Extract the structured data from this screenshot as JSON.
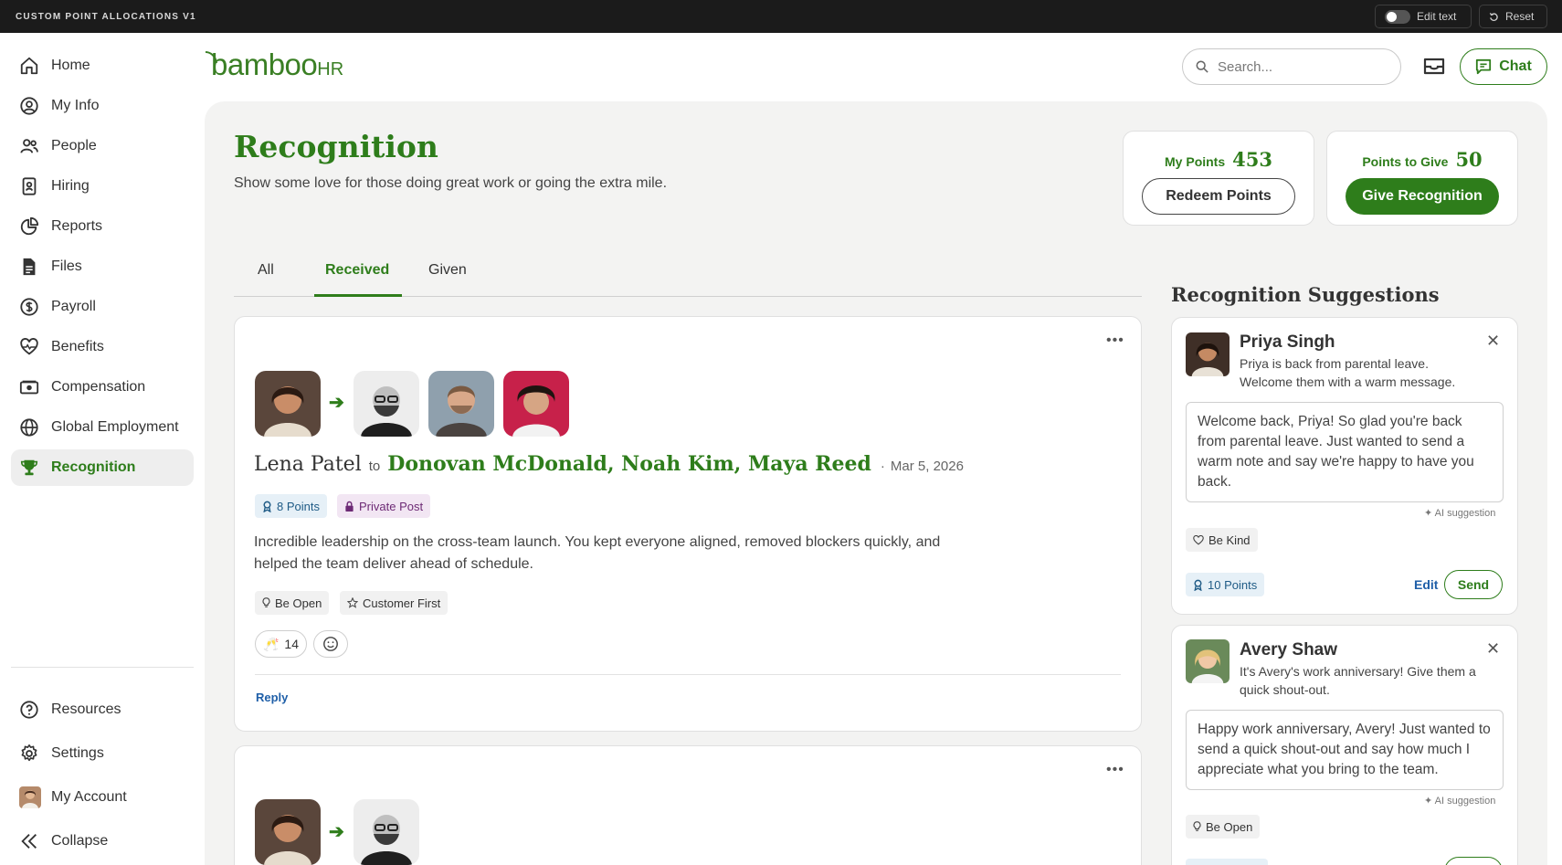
{
  "topbar": {
    "title": "CUSTOM POINT ALLOCATIONS V1",
    "edit_text": "Edit text",
    "reset": "Reset"
  },
  "sidebar": {
    "items": [
      {
        "label": "Home",
        "icon": "home-icon"
      },
      {
        "label": "My Info",
        "icon": "user-circle-icon"
      },
      {
        "label": "People",
        "icon": "people-icon"
      },
      {
        "label": "Hiring",
        "icon": "badge-icon"
      },
      {
        "label": "Reports",
        "icon": "pie-chart-icon"
      },
      {
        "label": "Files",
        "icon": "file-icon"
      },
      {
        "label": "Payroll",
        "icon": "dollar-circle-icon"
      },
      {
        "label": "Benefits",
        "icon": "heart-pulse-icon"
      },
      {
        "label": "Compensation",
        "icon": "cash-icon"
      },
      {
        "label": "Global Employment",
        "icon": "globe-icon"
      },
      {
        "label": "Recognition",
        "icon": "trophy-icon",
        "active": true
      }
    ],
    "bottom": [
      {
        "label": "Resources",
        "icon": "help-circle-icon"
      },
      {
        "label": "Settings",
        "icon": "gear-icon"
      },
      {
        "label": "My Account",
        "icon": "avatar"
      },
      {
        "label": "Collapse",
        "icon": "collapse-icon"
      }
    ]
  },
  "header": {
    "logo_main": "bamboo",
    "logo_hr": "HR",
    "search_placeholder": "Search...",
    "chat": "Chat"
  },
  "page": {
    "title": "Recognition",
    "subtitle": "Show some love for those doing great work or going the extra mile."
  },
  "points": {
    "my_points_label": "My Points",
    "my_points_value": "453",
    "redeem": "Redeem Points",
    "to_give_label": "Points to Give",
    "to_give_value": "50",
    "give": "Give Recognition"
  },
  "tabs": [
    {
      "label": "All"
    },
    {
      "label": "Received",
      "active": true
    },
    {
      "label": "Given"
    }
  ],
  "feed": [
    {
      "from": "Lena Patel",
      "to_word": "to",
      "recipients": "Donovan McDonald, Noah Kim, Maya Reed",
      "date": "Mar 5, 2026",
      "points": "8 Points",
      "privacy": "Private Post",
      "message": "Incredible leadership on the cross-team launch. You kept everyone aligned, removed blockers quickly, and helped the team deliver ahead of schedule.",
      "values": [
        "Be Open",
        "Customer First"
      ],
      "reaction_count": "14",
      "reply": "Reply"
    }
  ],
  "suggestions": {
    "title": "Recognition Suggestions",
    "items": [
      {
        "name": "Priya Singh",
        "desc": "Priya is back from parental leave. Welcome them with a warm message.",
        "message": "Welcome back, Priya! So glad you're back from parental leave. Just wanted to send a warm note and say we're happy to have you back.",
        "ai": "AI suggestion",
        "value": "Be Kind",
        "points": "10 Points",
        "edit": "Edit",
        "send": "Send"
      },
      {
        "name": "Avery Shaw",
        "desc": "It's Avery's work anniversary! Give them a quick shout-out.",
        "message": "Happy work anniversary, Avery! Just wanted to send a quick shout-out and say how much I appreciate what you bring to the team.",
        "ai": "AI suggestion",
        "value": "Be Open"
      }
    ]
  },
  "colors": {
    "brand_green": "#2e7d1b",
    "link_blue": "#1f5fa8",
    "topbar": "#1b1b1b",
    "panel": "#f3f3f2"
  }
}
